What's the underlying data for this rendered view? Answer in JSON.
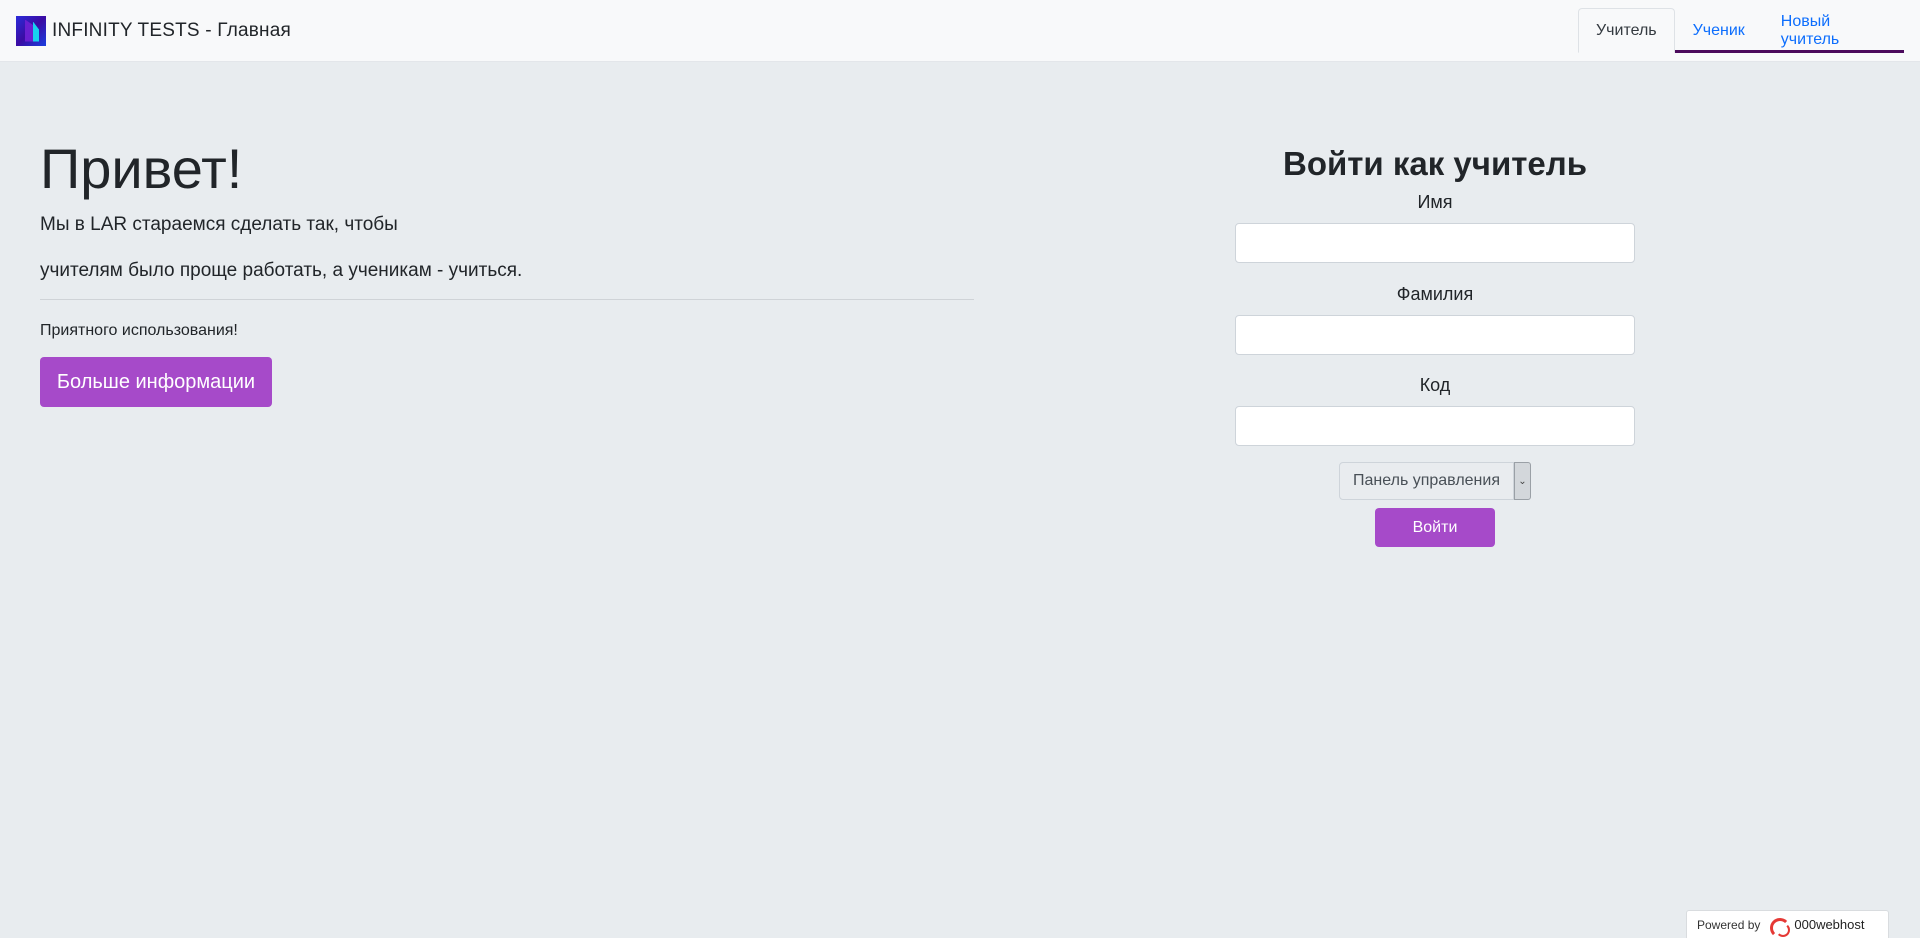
{
  "navbar": {
    "brand": "INFINITY TESTS - Главная",
    "logo_icon": "infinity-tests-logo",
    "tabs": [
      {
        "label": "Учитель",
        "active": true
      },
      {
        "label": "Ученик",
        "active": false
      },
      {
        "label": "Новый учитель",
        "active": false
      }
    ],
    "underline_color": "#4b0a5c"
  },
  "hero": {
    "title": "Привет!",
    "lead_line1": "Мы в LAR стараемся сделать так, чтобы",
    "lead_line2": "учителям было проще работать, а ученикам - учиться.",
    "note": "Приятного использования!",
    "more_button": "Больше информации"
  },
  "login": {
    "title": "Войти как учитель",
    "name_label": "Имя",
    "name_value": "",
    "surname_label": "Фамилия",
    "surname_value": "",
    "code_label": "Код",
    "code_value": "",
    "select_value": "Панель управления",
    "submit_button": "Войти"
  },
  "colors": {
    "accent": "#a64ac9",
    "link": "#0d6efd",
    "background": "#e8ecef"
  },
  "footer": {
    "powered_by": "Powered by",
    "host_name": "000webhost",
    "host_icon": "000webhost-logo"
  }
}
